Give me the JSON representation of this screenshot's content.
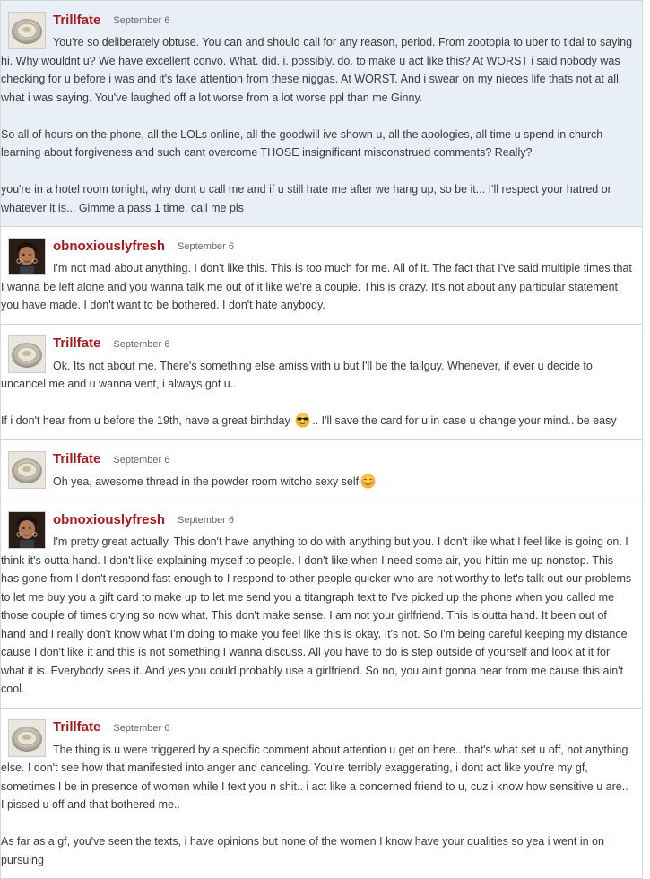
{
  "messages": [
    {
      "user": "Trillfate",
      "date": "September 6",
      "avatar": "silver-disc-avatar",
      "paragraphs": [
        "You're so deliberately obtuse. You can and should call for any reason, period. From zootopia to uber to tidal to saying hi. Why wouldnt u? We have excellent convo. What. did. i. possibly. do. to make u act like this? At WORST i said nobody was checking for u before i was and it's fake attention from these niggas. At WORST. And i swear on my nieces life thats not at all what i was saying. You've laughed off a lot worse from a lot worse ppl than me Ginny.",
        "So all of hours on the phone, all the LOLs online, all the goodwill ive shown u, all the apologies, all time u spend in church learning about forgiveness and such cant overcome THOSE insignificant misconstrued comments? Really?",
        "you're in a hotel room tonight, why dont u call me and if u still hate me after we hang up, so be it... I'll respect your hatred or whatever it is... Gimme a pass 1 time, call me pls"
      ]
    },
    {
      "user": "obnoxiouslyfresh",
      "date": "September 6",
      "avatar": "woman-photo-avatar",
      "paragraphs": [
        "I'm not mad about anything. I don't like this. This is too much for me. All of it. The fact that I've said multiple times that I wanna be left alone and you wanna talk me out of it like we're a couple. This is crazy. It's not about any particular statement you have made. I don't want to be bothered. I don't hate anybody."
      ]
    },
    {
      "user": "Trillfate",
      "date": "September 6",
      "avatar": "silver-disc-avatar",
      "paragraphs": [
        "Ok. Its not about me. There's something else amiss with u but I'll be the fallguy. Whenever, if ever u decide to uncancel me and u wanna vent, i always got u..",
        "If i don't hear from u before the 19th, have a great birthday",
        ".. I'll save the card for u in case u change your mind.. be easy"
      ]
    },
    {
      "user": "Trillfate",
      "date": "September 6",
      "avatar": "silver-disc-avatar",
      "paragraphs": [
        "Oh yea, awesome thread in the powder room witcho sexy self"
      ]
    },
    {
      "user": "obnoxiouslyfresh",
      "date": "September 6",
      "avatar": "woman-photo-avatar",
      "paragraphs": [
        "I'm pretty great actually. This don't have anything to do with anything but you. I don't like what I feel like is going on. I think it's outta hand. I don't like explaining myself to people. I don't like when I need some air, you hittin me up nonstop. This has gone from I don't respond fast enough to I respond to other people quicker who are not worthy to let's talk out our problems to let me buy you a gift card to make up to let me send you a titangraph text to I've picked up the phone when you called me those couple of times crying so now what. This don't make sense. I am not your girlfriend. This is outta hand. It been out of hand and I really don't know what I'm doing to make you feel like this is okay. It's not. So I'm being careful keeping my distance cause I don't like it and this is not something I wanna discuss. All you have to do is step outside of yourself and look at it for what it is. Everybody sees it. And yes you could probably use a girlfriend. So no, you ain't gonna hear from me cause this ain't cool."
      ]
    },
    {
      "user": "Trillfate",
      "date": "September 6",
      "avatar": "silver-disc-avatar",
      "paragraphs": [
        "The thing is u were triggered by a specific comment about attention u get on here.. that's what set u off, not anything else. I don't see how that manifested into anger and canceling. You're terribly exaggerating, i dont act like you're my gf, sometimes I be in presence of women while I text you n shit.. i act like a concerned friend to u, cuz i know how sensitive u are.. I pissed u off and that bothered me..",
        "As far as a gf, you've seen the texts, i have opinions but none of the women I know have your qualities so yea i went in on pursuing"
      ]
    }
  ],
  "emoji": {
    "sunglasses": "sunglasses-emoji",
    "blush": "blush-emoji"
  },
  "colors": {
    "username": "#b0171f",
    "highlight_bg": "#e9eff6",
    "divider": "#d3d3d3"
  }
}
